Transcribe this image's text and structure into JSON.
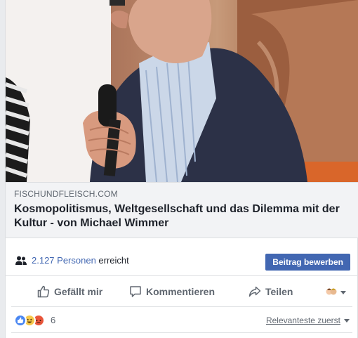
{
  "link_preview": {
    "domain": "FISCHUNDFLEISCH.COM",
    "title": "Kosmopolitismus, Weltgesellschaft und das Dilemma mit der Kultur - von Michael Wimmer"
  },
  "reach": {
    "count_text": "2.127 Personen",
    "label": " erreicht",
    "boost_button": "Beitrag bewerben"
  },
  "actions": {
    "like": "Gefällt mir",
    "comment": "Kommentieren",
    "share": "Teilen"
  },
  "reactions": {
    "count": "6",
    "icons": [
      "like-icon",
      "haha-icon",
      "angry-icon"
    ],
    "sort_label": "Relevanteste zuerst"
  },
  "colors": {
    "accent": "#4267b2",
    "text_secondary": "#606770",
    "meta_background": "#f2f3f5"
  }
}
